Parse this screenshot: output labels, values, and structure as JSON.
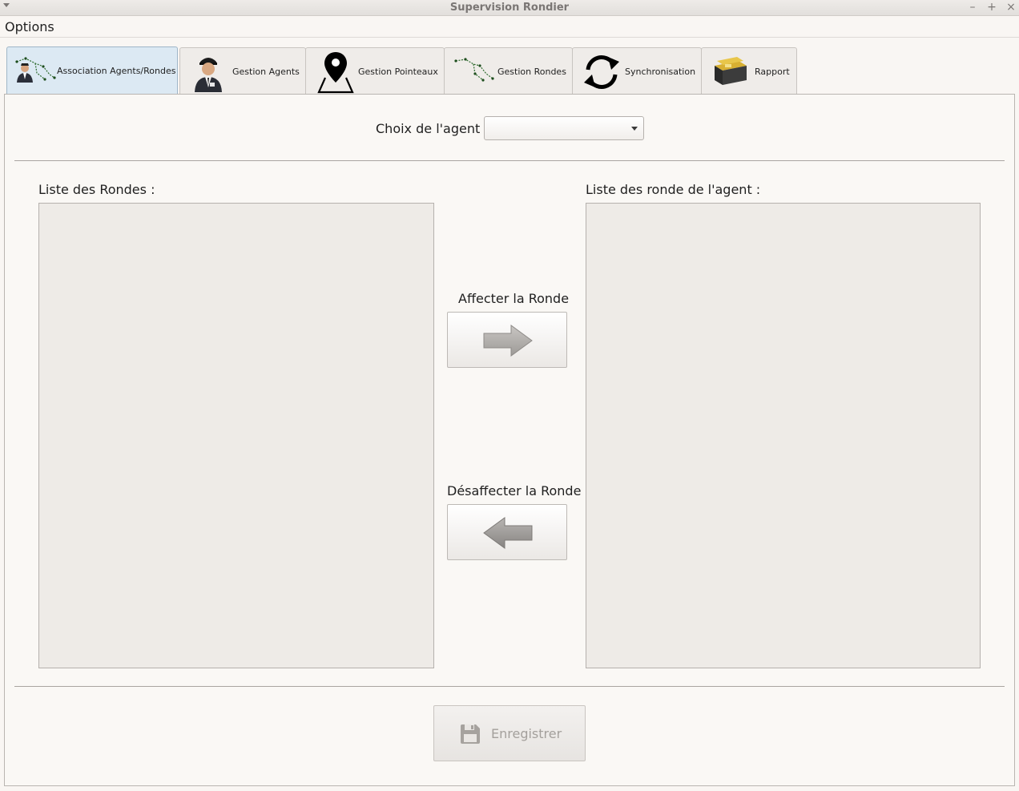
{
  "window": {
    "title": "Supervision Rondier"
  },
  "menubar": {
    "items": [
      {
        "label": "Options"
      }
    ]
  },
  "tabs": [
    {
      "label": "Association Agents/Rondes",
      "icon": "agent-route-icon",
      "active": true
    },
    {
      "label": "Gestion Agents",
      "icon": "security-agent-icon",
      "active": false
    },
    {
      "label": "Gestion Pointeaux",
      "icon": "map-pin-icon",
      "active": false
    },
    {
      "label": "Gestion Rondes",
      "icon": "route-icon",
      "active": false
    },
    {
      "label": "Synchronisation",
      "icon": "sync-icon",
      "active": false
    },
    {
      "label": "Rapport",
      "icon": "report-box-icon",
      "active": false
    }
  ],
  "agent_choice": {
    "label": "Choix de l'agent :",
    "value": ""
  },
  "left_list": {
    "label": "Liste des Rondes :",
    "items": []
  },
  "right_list": {
    "label": "Liste des ronde de l'agent :",
    "items": []
  },
  "assign": {
    "label": "Affecter la Ronde",
    "icon": "arrow-right-icon"
  },
  "unassign": {
    "label": "Désaffecter la Ronde",
    "icon": "arrow-left-icon"
  },
  "save": {
    "label": "Enregistrer",
    "enabled": false,
    "icon": "floppy-disk-icon"
  },
  "colors": {
    "active_tab": "#dce9f3",
    "panel_bg": "#faf8f5",
    "list_bg": "#eeebe7",
    "disabled_text": "#a4a09c"
  }
}
